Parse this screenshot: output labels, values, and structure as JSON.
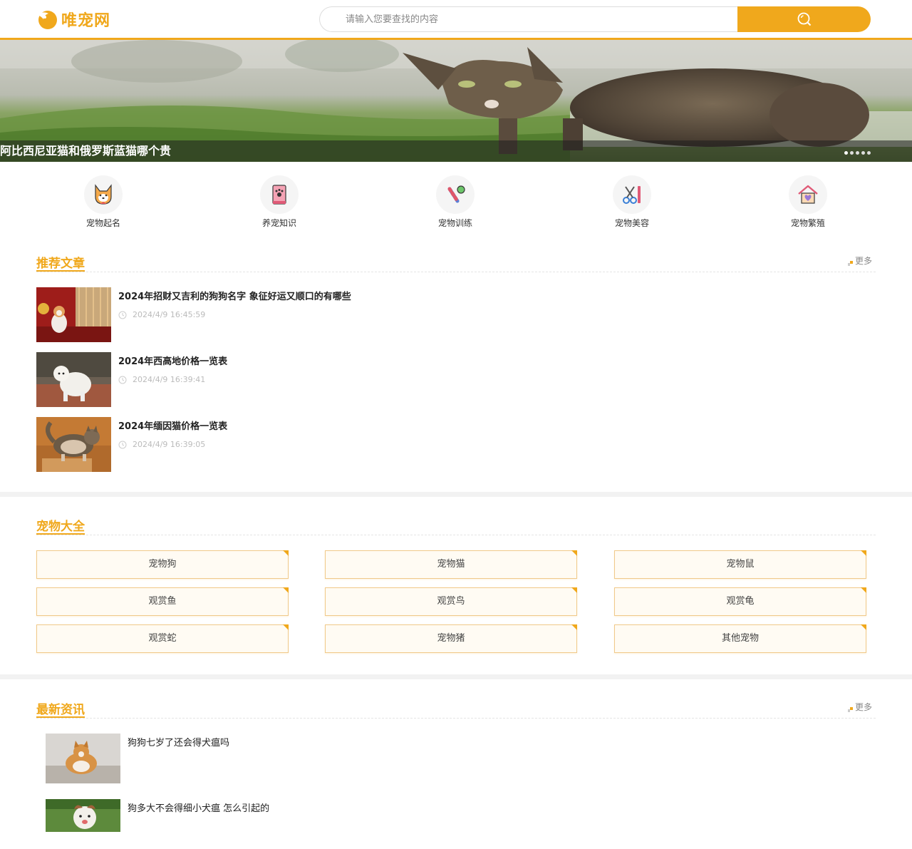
{
  "header": {
    "logo_text": "唯宠网",
    "search_placeholder": "请输入您要查找的内容"
  },
  "banner": {
    "caption": "阿比西尼亚猫和俄罗斯蓝猫哪个贵",
    "slide_count": 5
  },
  "categories": [
    {
      "label": "宠物起名",
      "icon": "shiba-dog-icon"
    },
    {
      "label": "养宠知识",
      "icon": "paw-book-icon"
    },
    {
      "label": "宠物训练",
      "icon": "bone-toy-icon"
    },
    {
      "label": "宠物美容",
      "icon": "scissors-comb-icon"
    },
    {
      "label": "宠物繁殖",
      "icon": "pet-house-icon"
    }
  ],
  "recommended": {
    "title": "推荐文章",
    "more_label": "更多",
    "articles": [
      {
        "title": "2024年招财又吉利的狗狗名字 象征好运又顺口的有哪些",
        "time": "2024/4/9 16:45:59"
      },
      {
        "title": "2024年西高地价格一览表",
        "time": "2024/4/9 16:39:41"
      },
      {
        "title": "2024年缅因猫价格一览表",
        "time": "2024/4/9 16:39:05"
      }
    ]
  },
  "pets": {
    "title": "宠物大全",
    "items": [
      "宠物狗",
      "宠物猫",
      "宠物鼠",
      "观赏鱼",
      "观赏鸟",
      "观赏龟",
      "观赏蛇",
      "宠物猪",
      "其他宠物"
    ]
  },
  "news": {
    "title": "最新资讯",
    "more_label": "更多",
    "items": [
      {
        "title": "狗狗七岁了还会得犬瘟吗"
      },
      {
        "title": "狗多大不会得细小犬瘟 怎么引起的"
      }
    ]
  },
  "colors": {
    "accent": "#f0a81c",
    "text": "#333333",
    "muted": "#bbbbbb"
  }
}
